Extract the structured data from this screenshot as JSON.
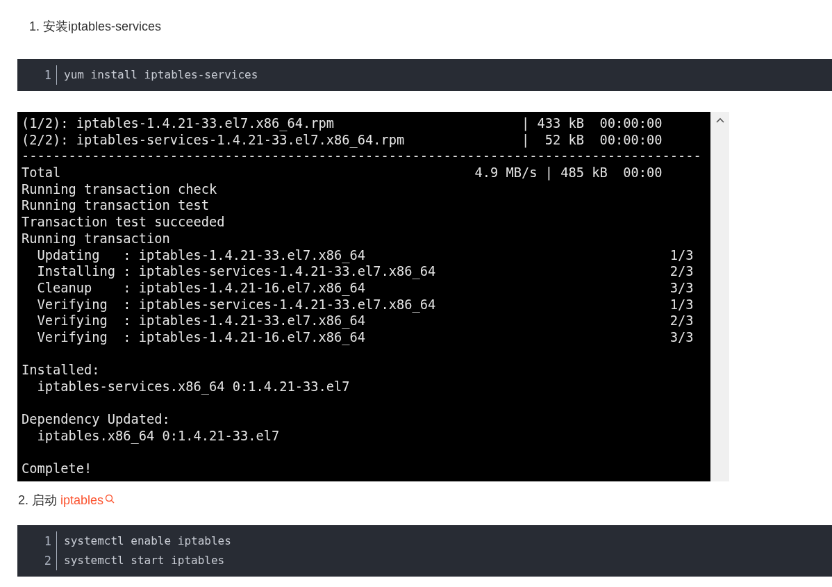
{
  "steps": [
    {
      "heading": {
        "number": "1.",
        "text": "安装iptables-services"
      },
      "code": {
        "lines": [
          {
            "number": "1",
            "text": "yum install iptables-services"
          }
        ]
      },
      "terminal": {
        "lines": [
          {
            "kind": "transfer",
            "left": "(1/2): iptables-1.4.21-33.el7.x86_64.rpm",
            "right": "| 433 kB  00:00:00"
          },
          {
            "kind": "transfer",
            "left": "(2/2): iptables-services-1.4.21-33.el7.x86_64.rpm",
            "right": "|  52 kB  00:00:00"
          },
          {
            "kind": "rule",
            "left": "---------------------------------------------------------------------------------------"
          },
          {
            "kind": "total",
            "left": "Total",
            "right": "4.9 MB/s | 485 kB  00:00"
          },
          {
            "kind": "plain",
            "left": "Running transaction check"
          },
          {
            "kind": "plain",
            "left": "Running transaction test"
          },
          {
            "kind": "plain",
            "left": "Transaction test succeeded"
          },
          {
            "kind": "plain",
            "left": "Running transaction"
          },
          {
            "kind": "step",
            "left": "  Updating   : iptables-1.4.21-33.el7.x86_64",
            "right": "1/3"
          },
          {
            "kind": "step",
            "left": "  Installing : iptables-services-1.4.21-33.el7.x86_64",
            "right": "2/3"
          },
          {
            "kind": "step",
            "left": "  Cleanup    : iptables-1.4.21-16.el7.x86_64",
            "right": "3/3"
          },
          {
            "kind": "step",
            "left": "  Verifying  : iptables-services-1.4.21-33.el7.x86_64",
            "right": "1/3"
          },
          {
            "kind": "step",
            "left": "  Verifying  : iptables-1.4.21-33.el7.x86_64",
            "right": "2/3"
          },
          {
            "kind": "step",
            "left": "  Verifying  : iptables-1.4.21-16.el7.x86_64",
            "right": "3/3"
          },
          {
            "kind": "blank"
          },
          {
            "kind": "plain",
            "left": "Installed:"
          },
          {
            "kind": "plain",
            "left": "  iptables-services.x86_64 0:1.4.21-33.el7"
          },
          {
            "kind": "blank"
          },
          {
            "kind": "plain",
            "left": "Dependency Updated:"
          },
          {
            "kind": "plain",
            "left": "  iptables.x86_64 0:1.4.21-33.el7"
          },
          {
            "kind": "blank"
          },
          {
            "kind": "plain",
            "left": "Complete!"
          }
        ]
      }
    },
    {
      "heading": {
        "number": "2.",
        "text": "启动 ",
        "link": "iptables"
      },
      "code": {
        "lines": [
          {
            "number": "1",
            "text": "systemctl enable iptables"
          },
          {
            "number": "2",
            "text": "systemctl start iptables"
          }
        ]
      }
    }
  ]
}
